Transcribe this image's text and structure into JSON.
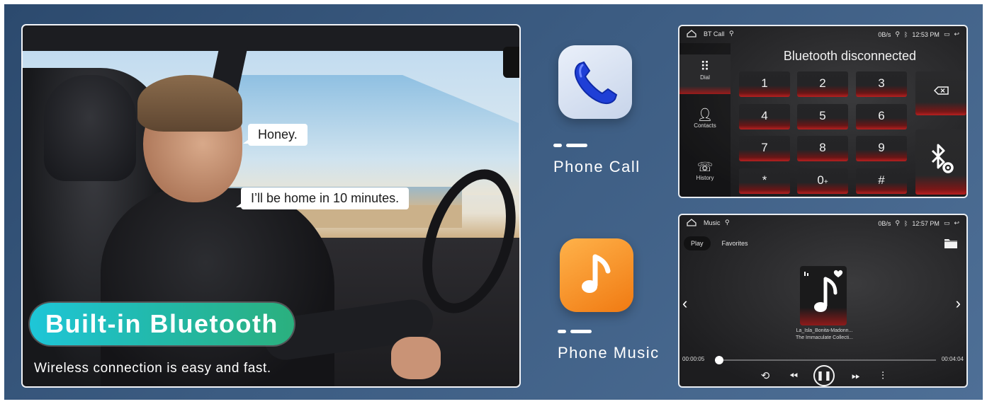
{
  "promo": {
    "bubble_1": "Honey.",
    "bubble_2": "I’ll be home in 10 minutes.",
    "headline": "Built-in Bluetooth",
    "tagline": "Wireless connection is easy and fast."
  },
  "features": [
    {
      "label": "Phone Call",
      "icon": "phone-app-icon"
    },
    {
      "label": "Phone Music",
      "icon": "music-app-icon"
    }
  ],
  "call_screen": {
    "app_title": "BT Call",
    "net_speed": "0B/s",
    "time": "12:53 PM",
    "status": "Bluetooth disconnected",
    "nav": [
      {
        "label": "Dial",
        "icon": "dialpad-icon",
        "active": true
      },
      {
        "label": "Contacts",
        "icon": "contacts-icon",
        "active": false
      },
      {
        "label": "History",
        "icon": "call-history-icon",
        "active": false
      }
    ],
    "keys": [
      "1",
      "2",
      "3",
      "4",
      "5",
      "6",
      "7",
      "8",
      "9",
      "*",
      "0",
      "#"
    ],
    "zero_sub": "+",
    "backspace_icon": "backspace-icon",
    "settings_icon": "bluetooth-settings-icon"
  },
  "music_screen": {
    "app_title": "Music",
    "net_speed": "0B/s",
    "time": "12:57 PM",
    "tabs": [
      "Play",
      "Favorites"
    ],
    "track_title": "La_Isla_Bonita-Madonn...",
    "album": "The Immaculate Collecti...",
    "elapsed": "00:00:05",
    "duration": "00:04:04",
    "progress": 0.02,
    "controls": [
      "repeat-icon",
      "previous-icon",
      "pause-icon",
      "next-icon",
      "equalizer-icon"
    ]
  },
  "colors": {
    "banner_bg": "#3c5c82",
    "accent_red": "#b82020",
    "pill_start": "#1ec6d8",
    "pill_end": "#2bb07e",
    "music_tile": "#f07a12",
    "phone_glyph": "#1f3fd6"
  }
}
